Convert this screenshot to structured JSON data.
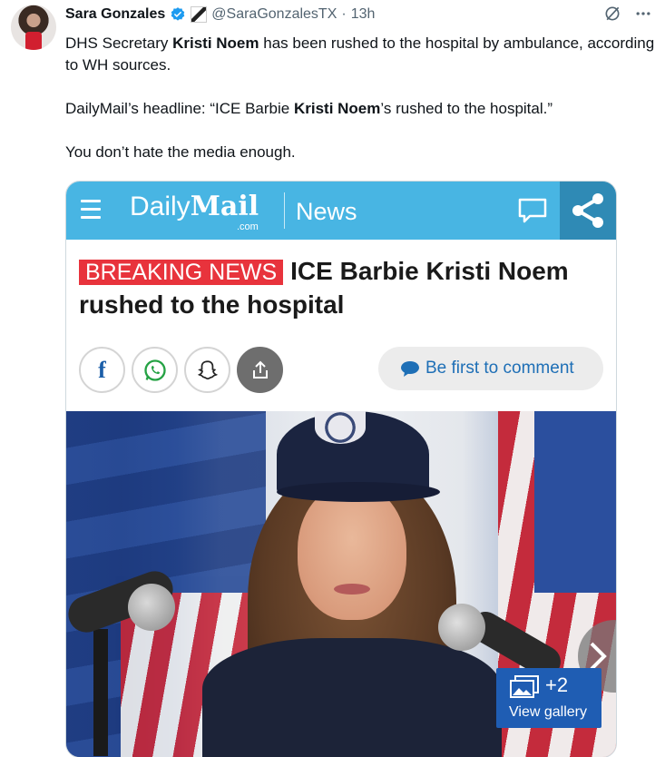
{
  "tweet": {
    "author_name": "Sara Gonzales",
    "handle": "@SaraGonzalesTX",
    "separator": "·",
    "time": "13h",
    "paragraph1": [
      "DHS Secretary ",
      "Kristi Noem",
      " has been rushed to the hospital by ambulance, according to WH sources."
    ],
    "paragraph2": [
      "DailyMail’s headline: “ICE Barbie ",
      "Kristi Noem",
      "’s rushed to the hospital.”"
    ],
    "paragraph3": "You don’t hate the media enough."
  },
  "icons": {
    "verified": "verified-badge-icon",
    "grok": "grok-icon",
    "more": "more-icon",
    "colors": {
      "brand_blue": "#48b5e3",
      "share_dark": "#2f8ab5",
      "breaking_red": "#e8333c",
      "verified_blue": "#1d9bf0"
    }
  },
  "card": {
    "logo_daily": "Daily",
    "logo_mail": "Mail",
    "logo_com": ".com",
    "section": "News",
    "breaking_label": "BREAKING NEWS",
    "headline": "ICE Barbie Kristi Noem rushed to the hospital",
    "comment_cta": "Be first to comment",
    "gallery_count": "+2",
    "gallery_label": "View gallery"
  }
}
